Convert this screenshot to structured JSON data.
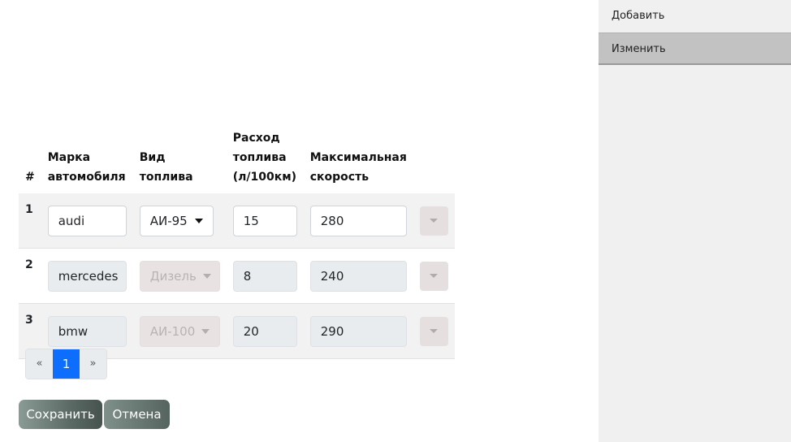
{
  "sidebar": {
    "items": [
      {
        "label": "Добавить"
      },
      {
        "label": "Изменить"
      }
    ]
  },
  "table": {
    "headers": {
      "num": "#",
      "brand": "Марка автомобиля",
      "fuel": "Вид топлива",
      "consumption": "Расход топлива (л/100км)",
      "speed": "Максимальная скорость"
    },
    "rows": [
      {
        "idx": "1",
        "brand": "audi",
        "fuel": "АИ-95",
        "consumption": "15",
        "speed": "280"
      },
      {
        "idx": "2",
        "brand": "mercedes",
        "fuel": "Дизель",
        "consumption": "8",
        "speed": "240"
      },
      {
        "idx": "3",
        "brand": "bmw",
        "fuel": "АИ-100",
        "consumption": "20",
        "speed": "290"
      }
    ]
  },
  "pagination": {
    "prev": "«",
    "current": "1",
    "next": "»"
  },
  "buttons": {
    "save": "Сохранить",
    "cancel": "Отмена"
  },
  "colors": {
    "accent": "#0d6efd",
    "sidebar_bg": "#f0f0f0",
    "sidebar_active": "#c2c2c2"
  }
}
